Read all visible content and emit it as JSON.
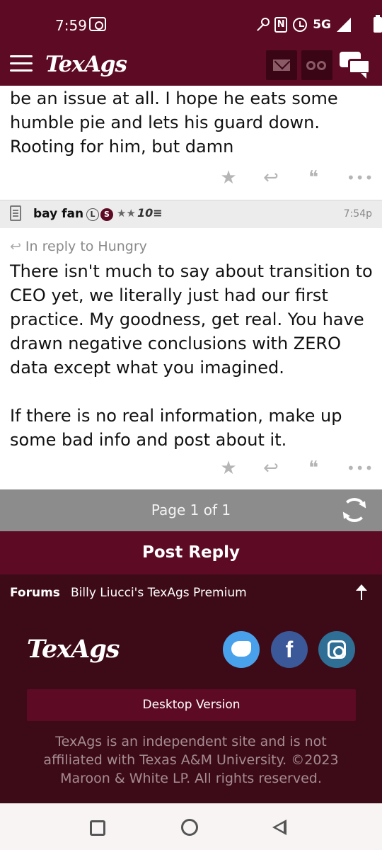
{
  "status_bar": {
    "time": "7:59",
    "network": "5G"
  },
  "app_header": {
    "logo_text": "TexAgs",
    "icons": [
      "menu-icon",
      "mail-icon",
      "binoculars-icon",
      "chat-icon"
    ]
  },
  "post1": {
    "text": "be an issue at all. I hope he eats some humble pie and lets his guard down. Rooting for him, but damn",
    "actions": [
      "star-icon",
      "reply-icon",
      "quote-icon",
      "more-icon"
    ]
  },
  "post2": {
    "username": "bay fan",
    "badge_l": "L",
    "badge_s": "S",
    "stars": "★★",
    "tier_badge": "10≡",
    "time": "7:54p",
    "reply_to": "In reply to Hungry",
    "text": "There isn't much to say about transition to CEO yet, we literally just had our first practice. My goodness, get real. You have drawn negative conclusions with ZERO data except what you imagined.\n\nIf there is no real information, make up some bad info and post about it.",
    "actions": [
      "star-icon",
      "reply-icon",
      "quote-icon",
      "more-icon"
    ]
  },
  "pager": {
    "label": "Page 1 of 1"
  },
  "post_reply_label": "Post Reply",
  "breadcrumb": {
    "forums": "Forums",
    "current": "Billy Liucci's TexAgs Premium"
  },
  "footer": {
    "logo_text": "TexAgs",
    "desktop_label": "Desktop Version",
    "disclaimer": "TexAgs is an independent site and is not affiliated with Texas A&M University. ©2023 Maroon & White LP. All rights reserved.",
    "social": [
      "twitter-icon",
      "facebook-icon",
      "instagram-icon"
    ],
    "fb_letter": "f"
  },
  "colors": {
    "maroon": "#5d0a24",
    "dark_maroon": "#3d0b17",
    "pager_gray": "#8c8c8c"
  }
}
